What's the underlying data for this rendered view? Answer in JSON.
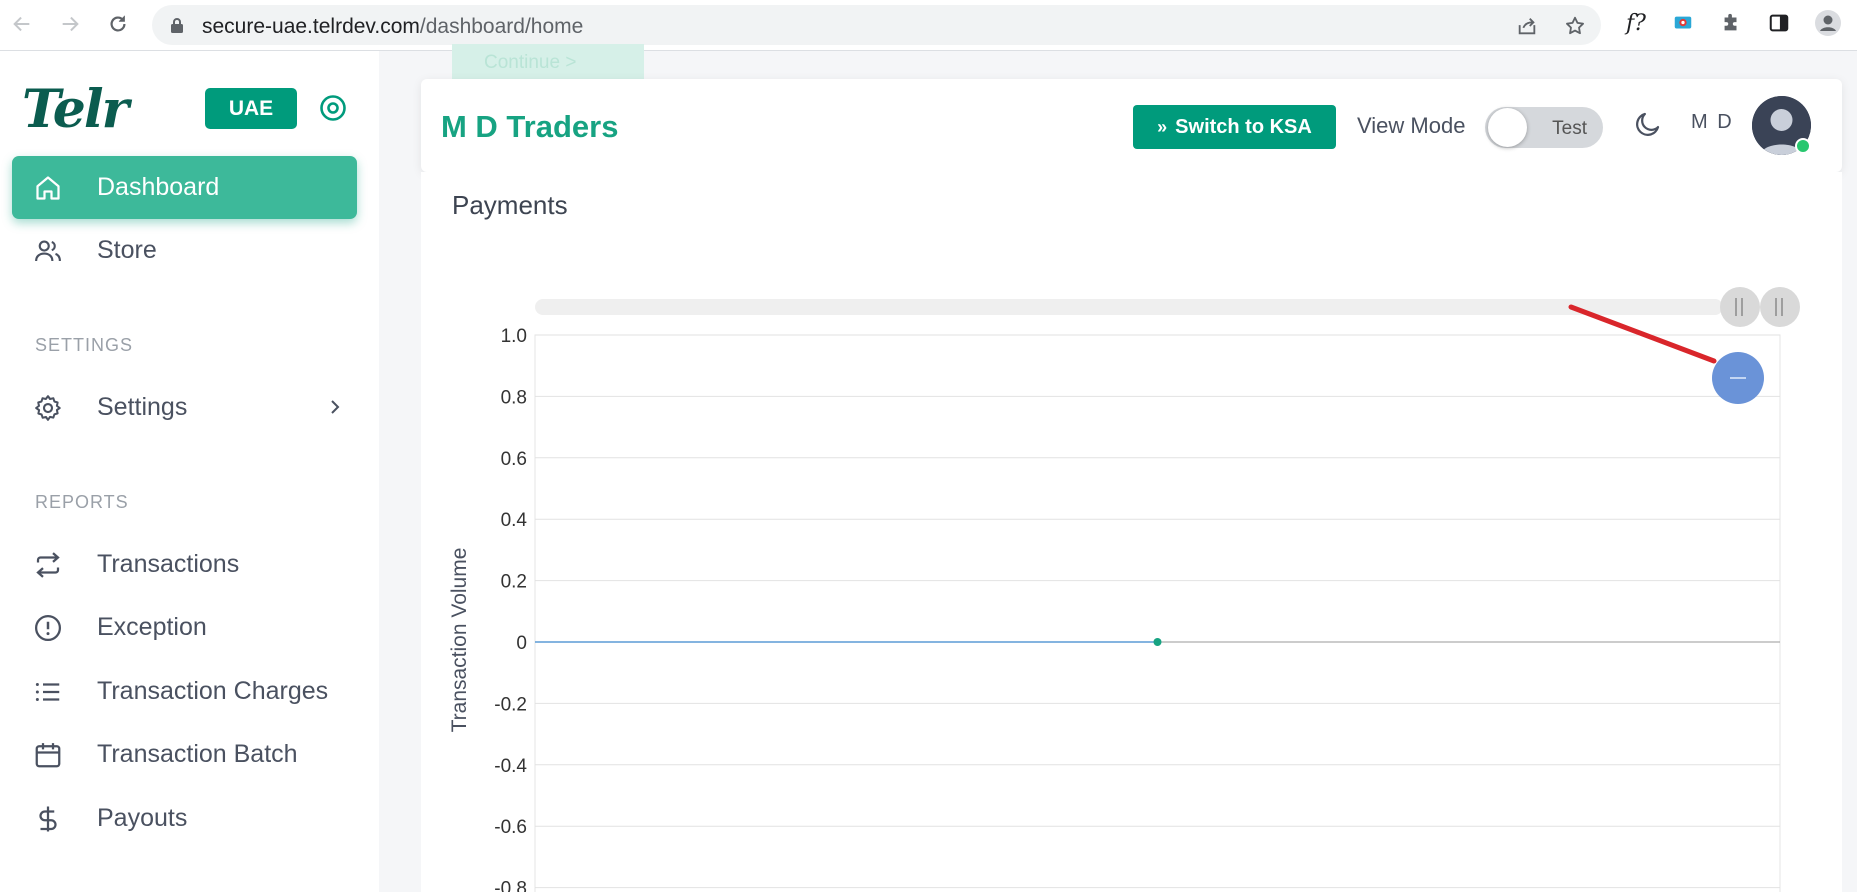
{
  "browser": {
    "url_host": "secure-uae.telrdev.com",
    "url_path": "/dashboard/home",
    "ext_label": "f?"
  },
  "sidebar": {
    "logo": "Telr",
    "region": "UAE",
    "items_main": [
      {
        "label": "Dashboard",
        "icon": "home-icon",
        "active": true
      },
      {
        "label": "Store",
        "icon": "users-icon",
        "active": false
      }
    ],
    "settings_section": "SETTINGS",
    "settings_item": {
      "label": "Settings",
      "icon": "gear-icon"
    },
    "reports_section": "REPORTS",
    "reports_items": [
      {
        "label": "Transactions",
        "icon": "repeat-icon"
      },
      {
        "label": "Exception",
        "icon": "alert-circle-icon"
      },
      {
        "label": "Transaction Charges",
        "icon": "list-icon"
      },
      {
        "label": "Transaction Batch",
        "icon": "calendar-icon"
      },
      {
        "label": "Payouts",
        "icon": "dollar-icon"
      }
    ]
  },
  "header": {
    "ghost_button": "Continue >",
    "merchant_name": "M D Traders",
    "switch_button": "Switch to KSA",
    "view_mode_label": "View Mode",
    "toggle_value": "Test",
    "user_initials": "M D"
  },
  "colors": {
    "brand": "#009b7c",
    "active_nav": "#3db99a",
    "annotation_arrow": "#d9262b",
    "zoom_button": "#6a93d8"
  },
  "main": {
    "title": "Payments"
  },
  "chart_data": {
    "type": "line",
    "title": "",
    "xlabel": "",
    "ylabel": "Transaction Volume",
    "ylim": [
      -0.8,
      1.0
    ],
    "yticks": [
      "1.0",
      "0.8",
      "0.6",
      "0.4",
      "0.2",
      "0",
      "-0.2",
      "-0.4",
      "-0.6",
      "-0.8"
    ],
    "grid": true,
    "series": [
      {
        "values": [
          0,
          0
        ],
        "point_index": 1
      }
    ]
  }
}
